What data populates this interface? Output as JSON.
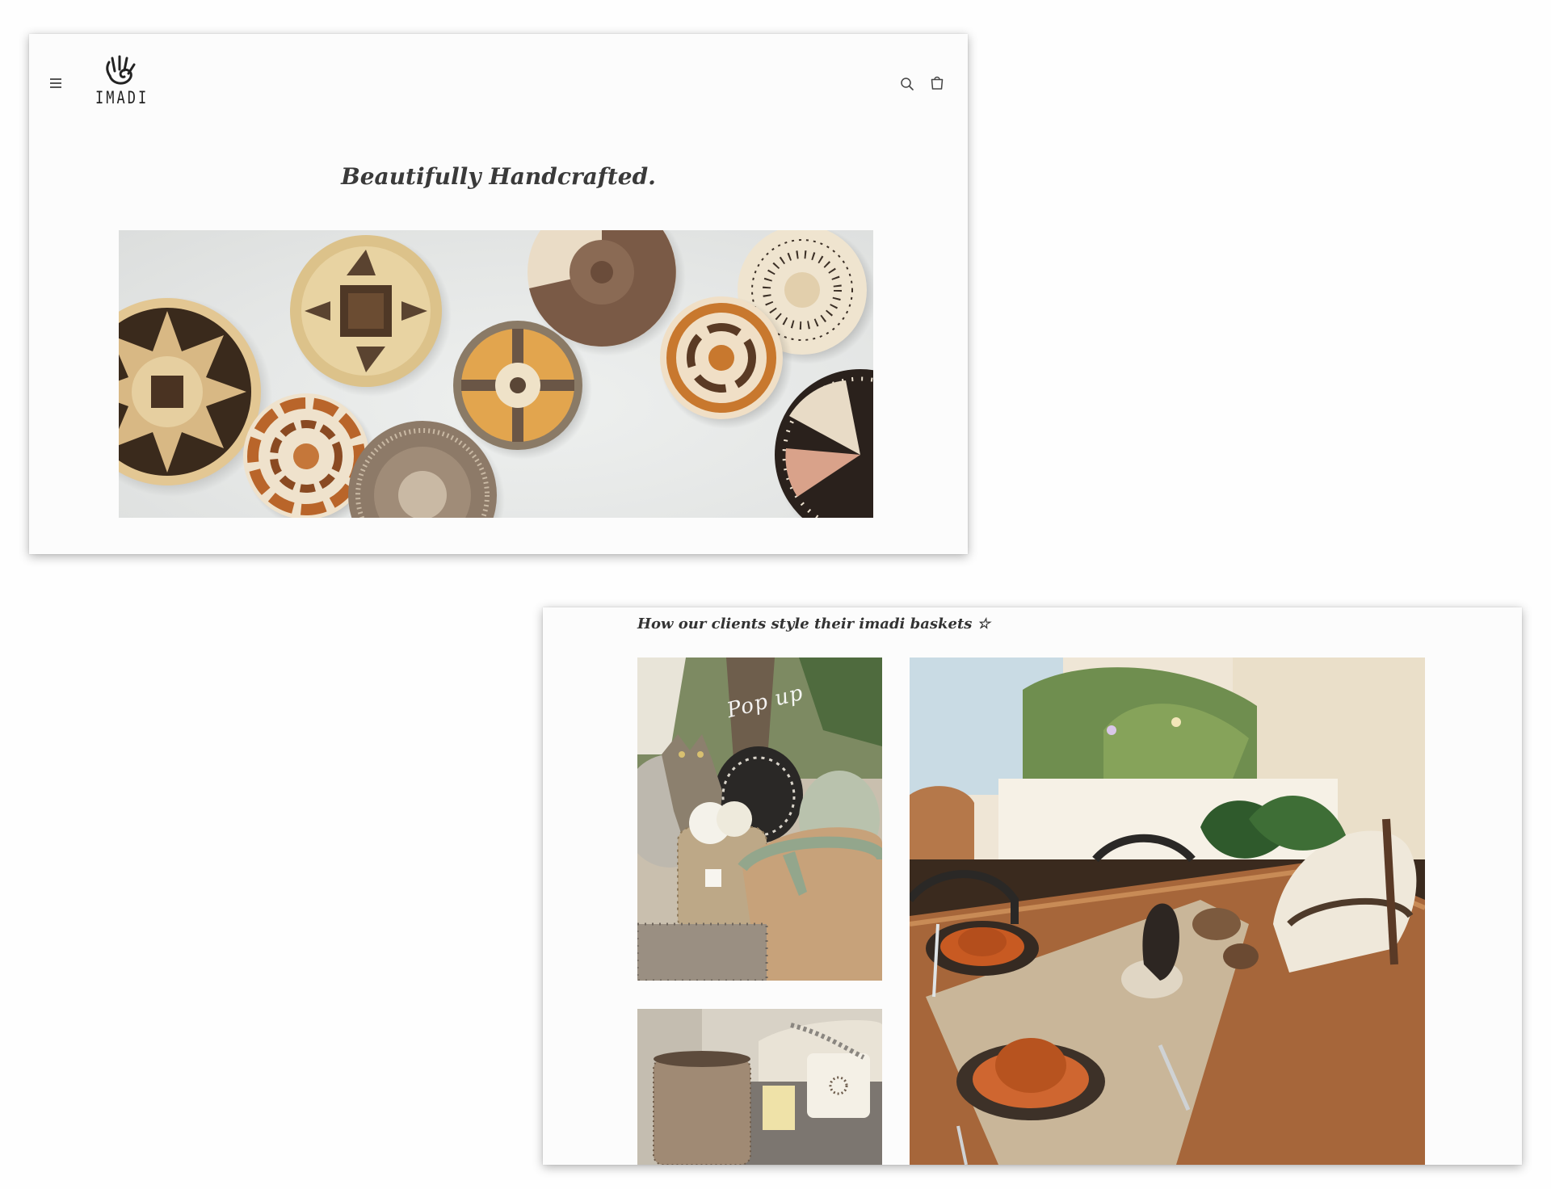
{
  "window_1": {
    "brand": {
      "name": "IMADI",
      "logo_icon": "hand-spiral-logo-icon"
    },
    "header": {
      "menu_icon": "hamburger-menu-icon",
      "search_icon": "search-icon",
      "cart_icon": "cart-icon"
    },
    "hero": {
      "title": "Beautifully Handcrafted.",
      "image": "woven-wall-baskets"
    }
  },
  "window_2": {
    "gallery": {
      "heading": "How our clients style their imadi baskets ☆",
      "photos": [
        {
          "name": "pop-up-display",
          "overlay_text": "Pop up",
          "tag_text": ""
        },
        {
          "name": "living-room-basket"
        },
        {
          "name": "dining-table-setting"
        }
      ]
    }
  },
  "colors": {
    "page_background": "#fefefe",
    "card_background": "#fcfcfc",
    "text_primary": "#3a3a3a",
    "icon_color": "#444444"
  }
}
